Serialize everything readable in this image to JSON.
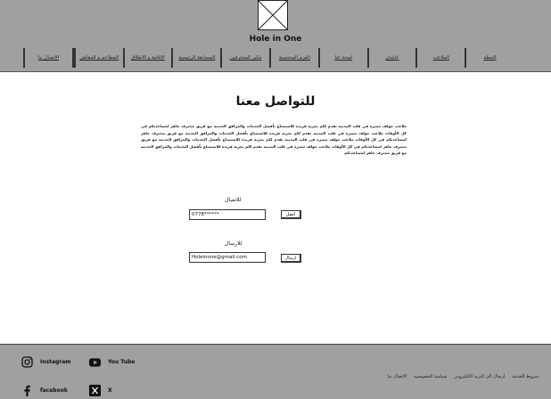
{
  "header": {
    "brand": "Hole in One",
    "nav": [
      "الخطة",
      "الملاعب",
      "عاشان",
      "لمحة عنا",
      "العزم المحتسبة",
      "مكبر المحترفين",
      "المسابقة الرئيسية",
      "الاقامة و الاطلاق",
      "المطاعم و المقاهي",
      "الاتصال بنا"
    ]
  },
  "main": {
    "title": "للتواصل معنا",
    "paragraph": "ملاعب جولف مميزة في قلب المدينة نقدم لكم تجربة فريدة للاستمتاع بأفضل الخدمات والمرافق الحديثة مع فريق محترف جاهز لمساعدتكم في كل الأوقات ملاعب جولف مميزة في قلب المدينة نقدم لكم تجربة فريدة للاستمتاع بأفضل الخدمات والمرافق الحديثة مع فريق محترف جاهز لمساعدتكم في كل الأوقات ملاعب جولف مميزة في قلب المدينة نقدم لكم تجربة فريدة للاستمتاع بأفضل الخدمات والمرافق الحديثة مع فريق محترف جاهز لمساعدتكم في كل الأوقات ملاعب جولف مميزة في قلب المدينة نقدم لكم تجربة فريدة للاستمتاع بأفضل الخدمات والمرافق الحديثة مع فريق محترف جاهز لمساعدتكم",
    "phone_label": "للاتصال",
    "phone_value": "0778******",
    "phone_button": "اتصل",
    "email_label": "للارسال",
    "email_value": "Holeinone@gmail.com",
    "email_button": "ارسال"
  },
  "footer": {
    "instagram": "Instagram",
    "youtube": "You Tube",
    "facebook": "facebook",
    "x": "X",
    "links": [
      "شروط الخدمة",
      "أرسال الى البريد الالكتروني",
      "سياسة الخصوصية",
      "الاتصال بنا"
    ]
  }
}
